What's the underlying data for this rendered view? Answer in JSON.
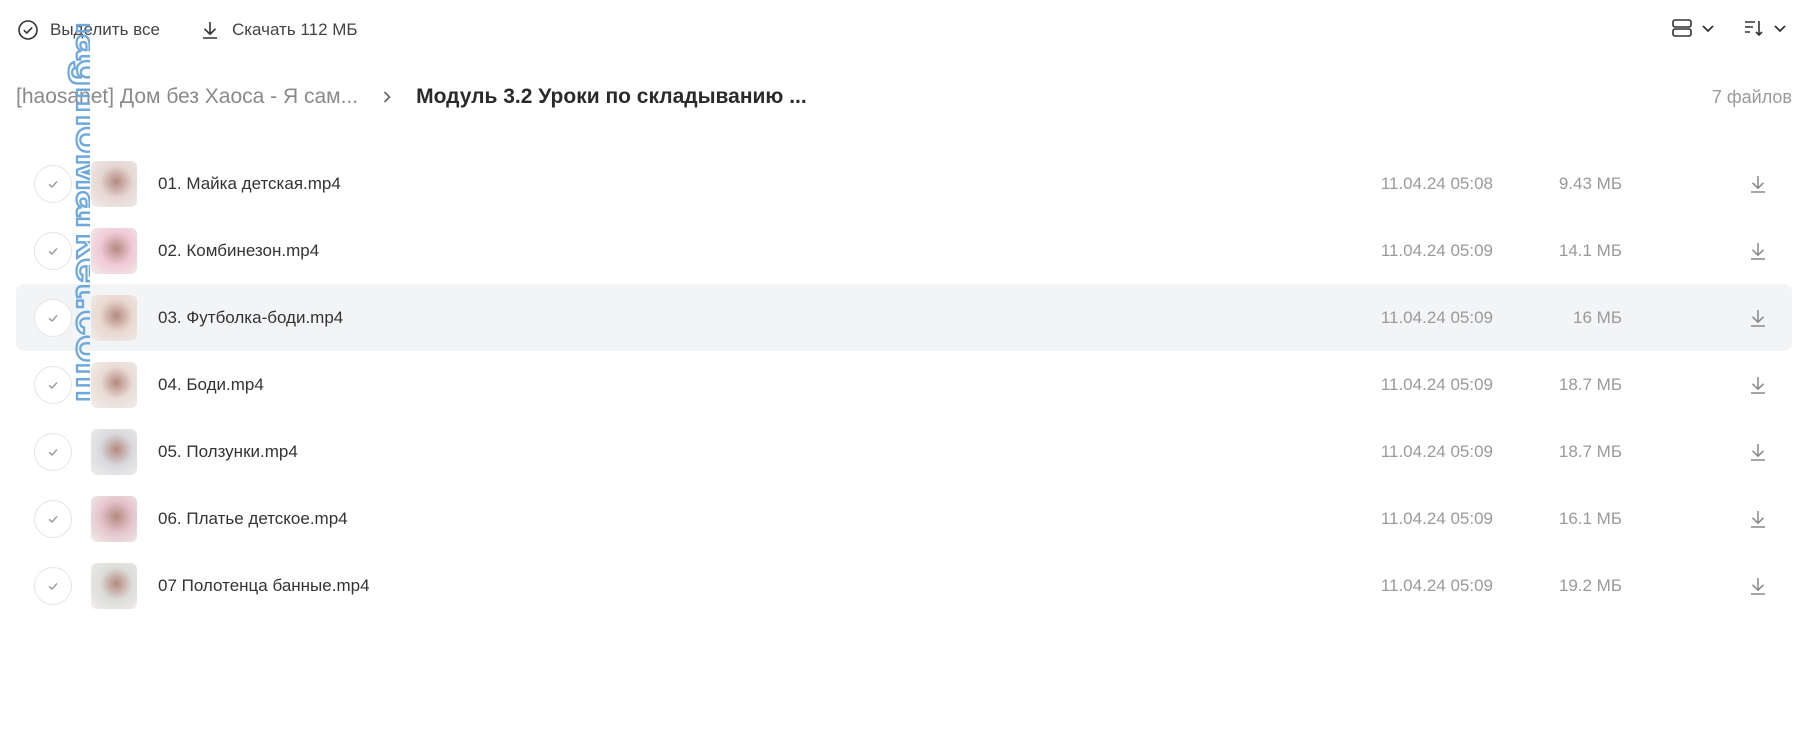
{
  "toolbar": {
    "select_all_label": "Выделить все",
    "download_label": "Скачать 112 МБ"
  },
  "breadcrumb": {
    "parent": "[haosanet] Дом без Хаоса - Я сам...",
    "current": "Модуль 3.2 Уроки по складыванию ...",
    "file_count": "7 файлов"
  },
  "files": [
    {
      "name": "01. Майка детская.mp4",
      "date": "11.04.24 05:08",
      "size": "9.43 МБ",
      "thumb_color": "#e6d6d2"
    },
    {
      "name": "02. Комбинезон.mp4",
      "date": "11.04.24 05:09",
      "size": "14.1 МБ",
      "thumb_color": "#f0c9d6"
    },
    {
      "name": "03. Футболка-боди.mp4",
      "date": "11.04.24 05:09",
      "size": "16 МБ",
      "thumb_color": "#e8d7cf"
    },
    {
      "name": "04. Боди.mp4",
      "date": "11.04.24 05:09",
      "size": "18.7 МБ",
      "thumb_color": "#eadcd6"
    },
    {
      "name": "05. Ползунки.mp4",
      "date": "11.04.24 05:09",
      "size": "18.7 МБ",
      "thumb_color": "#d9d9de"
    },
    {
      "name": "06. Платье детское.mp4",
      "date": "11.04.24 05:09",
      "size": "16.1 МБ",
      "thumb_color": "#e3c4cc"
    },
    {
      "name": "07 Полотенца банные.mp4",
      "date": "11.04.24 05:09",
      "size": "19.2 МБ",
      "thumb_color": "#dcdcd8"
    }
  ],
  "watermark": "lagmoMarket.com",
  "colors": {
    "watermark": "#6fa8dc",
    "hover_row": "#f3f4f6",
    "muted_text": "#9a9a9a"
  }
}
